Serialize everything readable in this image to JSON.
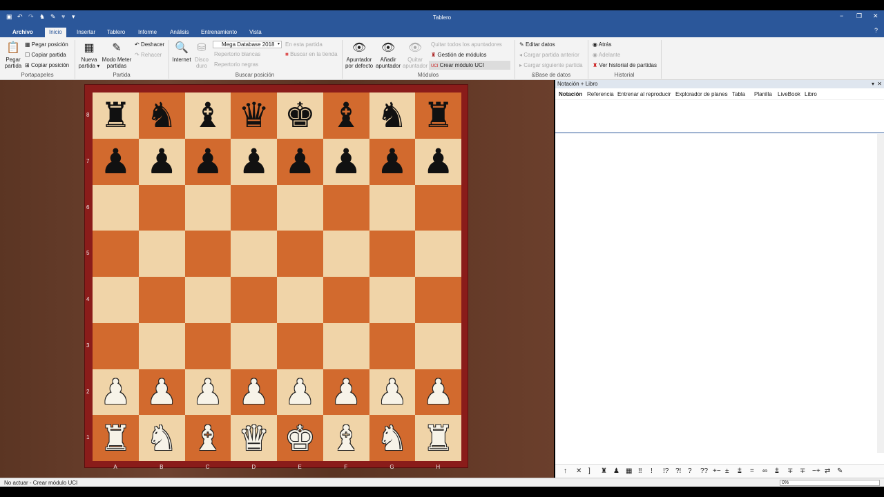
{
  "window": {
    "title": "Tablero"
  },
  "tabs": [
    "Archivo",
    "Inicio",
    "Insertar",
    "Tablero",
    "Informe",
    "Análisis",
    "Entrenamiento",
    "Vista"
  ],
  "ribbon": {
    "pegar_partida": "Pegar partida",
    "pegar_posicion": "Pegar posición",
    "copiar_partida": "Copiar partida",
    "copiar_posicion": "Copiar posición",
    "nueva_partida": "Nueva partida",
    "modo_meter": "Modo Meter partidas",
    "deshacer": "Deshacer",
    "rehacer": "Rehacer",
    "internet": "Internet",
    "disco_duro": "Disco duro",
    "database": "Mega Database 2018",
    "repertorio_blancas": "Repertorio blancas",
    "repertorio_negras": "Repertorio negras",
    "en_esta_partida": "En esta partida",
    "buscar_tienda": "Buscar en la tienda",
    "apuntador_defecto": "Apuntador por defecto",
    "anadir_apuntador": "Añadir apuntador",
    "quitar_apuntador": "Quitar apuntador",
    "quitar_todos": "Quitar todos los apuntadores",
    "gestion_modulos": "Gestión de módulos",
    "crear_uci": "Crear módulo UCI",
    "editar_datos": "Editar datos",
    "cargar_anterior": "Cargar partida anterior",
    "cargar_siguiente": "Cargar siguiente partida",
    "atras": "Atrás",
    "adelante": "Adelante",
    "ver_historial": "Ver historial de partidas",
    "groups": [
      "Portapapeles",
      "Partida",
      "Buscar posición",
      "Módulos",
      "&Base de datos",
      "Historial"
    ]
  },
  "board": {
    "files": [
      "A",
      "B",
      "C",
      "D",
      "E",
      "F",
      "G",
      "H"
    ],
    "ranks": [
      "8",
      "7",
      "6",
      "5",
      "4",
      "3",
      "2",
      "1"
    ],
    "position": [
      "rnbqkbnr",
      "pppppppp",
      "........",
      "........",
      "........",
      "........",
      "PPPPPPPP",
      "RNBQKBNR"
    ],
    "colors": {
      "light": "#f0d4a8",
      "dark": "#d26a2e",
      "frame": "#8a1c1a"
    }
  },
  "panel": {
    "title": "Notación + Libro",
    "tabs": [
      "Notación",
      "Referencia",
      "Entrenar al reproducir",
      "Explorador de planes",
      "Tabla",
      "Planilla",
      "LiveBook",
      "Libro"
    ],
    "annotations": [
      "↑",
      "✕",
      "]",
      "♜",
      "♟",
      "▦",
      "!!",
      "!",
      "!?",
      "?!",
      "?",
      "??",
      "+−",
      "±",
      "⩲",
      "=",
      "∞",
      "⩲",
      "∓",
      "∓",
      "−+",
      "⇄",
      "✎"
    ]
  },
  "status": {
    "text": "No actuar - Crear módulo UCI",
    "progress": "0%"
  }
}
